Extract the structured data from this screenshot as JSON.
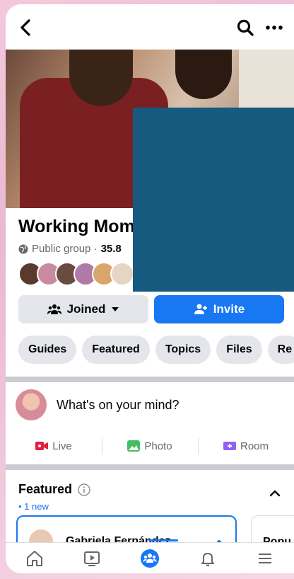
{
  "header": {
    "back_icon": "chevron-left-icon",
    "search_icon": "search-icon",
    "more_icon": "more-horizontal-icon"
  },
  "group": {
    "title": "Working Mom",
    "privacy_label": "Public group ·",
    "member_count_fragment": "35.8"
  },
  "buttons": {
    "joined_label": "Joined",
    "invite_label": "Invite"
  },
  "chips": [
    "Guides",
    "Featured",
    "Topics",
    "Files",
    "Re"
  ],
  "composer": {
    "placeholder": "What's on your mind?"
  },
  "composer_actions": [
    {
      "label": "Live",
      "icon": "live-video-icon",
      "color": "#e41e3f"
    },
    {
      "label": "Photo",
      "icon": "photo-icon",
      "color": "#45bd62"
    },
    {
      "label": "Room",
      "icon": "room-icon",
      "color": "#9360f7"
    }
  ],
  "featured": {
    "title": "Featured",
    "new_label": "• 1 new",
    "card_name": "Gabriela Fernández",
    "second_card_label": "Popu"
  },
  "bottom_nav": [
    {
      "name": "home",
      "icon": "home-icon",
      "active": false
    },
    {
      "name": "watch",
      "icon": "video-icon",
      "active": false
    },
    {
      "name": "groups",
      "icon": "groups-icon",
      "active": true
    },
    {
      "name": "notifications",
      "icon": "bell-icon",
      "active": false
    },
    {
      "name": "menu",
      "icon": "hamburger-menu-icon",
      "active": false
    }
  ],
  "colors": {
    "accent": "#1877f2",
    "overlay": "#165a7f"
  }
}
